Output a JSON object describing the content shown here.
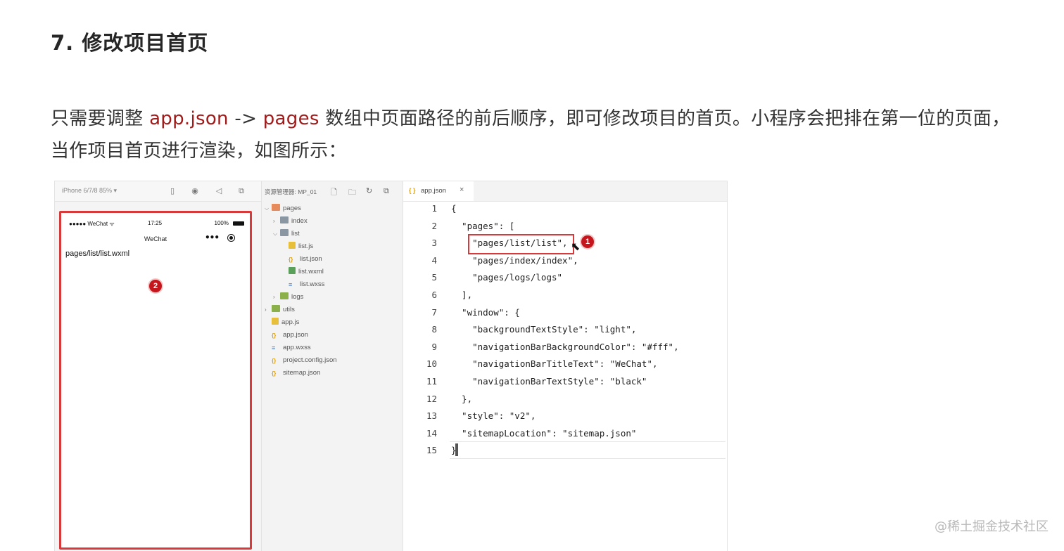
{
  "heading": "7. 修改项目首页",
  "paragraph": {
    "part1": "只需要调整 ",
    "code1": "app.json",
    "part2": " -> ",
    "code2": "pages",
    "part3": " 数组中页面路径的前后顺序，即可修改项目的首页。小程序会把排在第一位的页面，当作项目首页进行渲染，如图所示："
  },
  "simulator": {
    "device_label": "iPhone 6/7/8 85% ▾",
    "status_left": "●●●●● WeChat ᯤ",
    "status_time": "17:25",
    "status_battery": "100%",
    "navbar_title": "WeChat",
    "capsule_dots": "•••",
    "page_text": "pages/list/list.wxml",
    "badge": "2"
  },
  "explorer": {
    "title": "资源管理器: MP_01",
    "tree": [
      {
        "label": "pages",
        "icon": "folder-red",
        "chev": "⌵",
        "depth": 0
      },
      {
        "label": "index",
        "icon": "folder-gray",
        "chev": "›",
        "depth": 1
      },
      {
        "label": "list",
        "icon": "folder-gray",
        "chev": "⌵",
        "depth": 1
      },
      {
        "label": "list.js",
        "icon": "js",
        "chev": "",
        "depth": 2
      },
      {
        "label": "list.json",
        "icon": "json",
        "chev": "",
        "depth": 2
      },
      {
        "label": "list.wxml",
        "icon": "wxml",
        "chev": "",
        "depth": 2
      },
      {
        "label": "list.wxss",
        "icon": "wxss",
        "chev": "",
        "depth": 2
      },
      {
        "label": "logs",
        "icon": "folder-green",
        "chev": "›",
        "depth": 1
      },
      {
        "label": "utils",
        "icon": "folder-green",
        "chev": "›",
        "depth": 0
      },
      {
        "label": "app.js",
        "icon": "js",
        "chev": "",
        "depth": 0
      },
      {
        "label": "app.json",
        "icon": "json",
        "chev": "",
        "depth": 0
      },
      {
        "label": "app.wxss",
        "icon": "wxss",
        "chev": "",
        "depth": 0
      },
      {
        "label": "project.config.json",
        "icon": "json",
        "chev": "",
        "depth": 0
      },
      {
        "label": "sitemap.json",
        "icon": "json",
        "chev": "",
        "depth": 0
      }
    ]
  },
  "editor": {
    "tab_icon": "{ }",
    "tab_name": "app.json",
    "tab_close": "×",
    "badge": "1",
    "line_numbers": [
      "1",
      "2",
      "3",
      "4",
      "5",
      "6",
      "7",
      "8",
      "9",
      "10",
      "11",
      "12",
      "13",
      "14",
      "15"
    ],
    "lines": [
      "{",
      "  \"pages\": [",
      "    \"pages/list/list\",",
      "    \"pages/index/index\",",
      "    \"pages/logs/logs\"",
      "  ],",
      "  \"window\": {",
      "    \"backgroundTextStyle\": \"light\",",
      "    \"navigationBarBackgroundColor\": \"#fff\",",
      "    \"navigationBarTitleText\": \"WeChat\",",
      "    \"navigationBarTextStyle\": \"black\"",
      "  },",
      "  \"style\": \"v2\",",
      "  \"sitemapLocation\": \"sitemap.json\"",
      "}"
    ]
  },
  "watermark": "@稀土掘金技术社区",
  "colors": {
    "code_highlight": "#a11a1a",
    "annotation_red": "#d73a3a"
  }
}
